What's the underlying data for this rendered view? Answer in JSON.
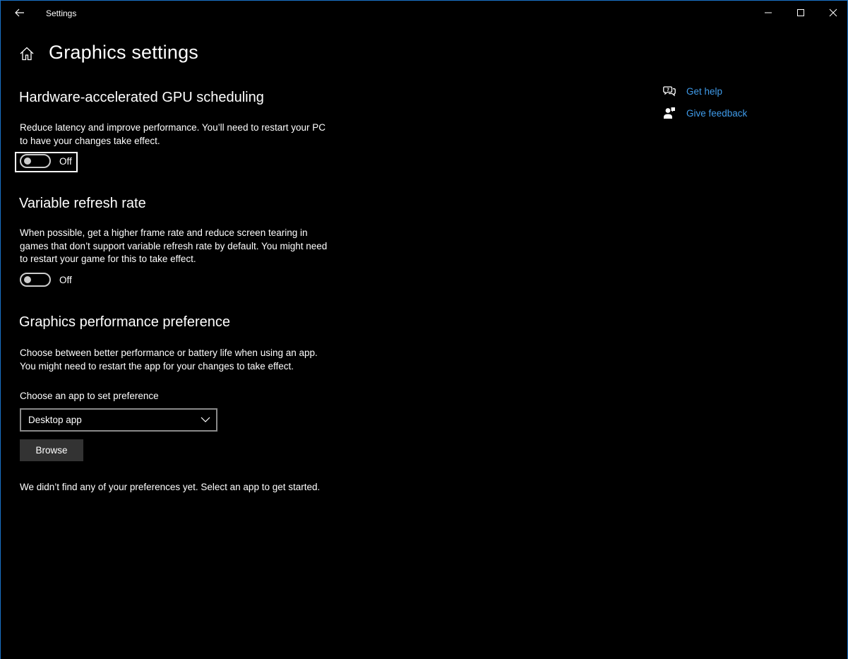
{
  "window": {
    "title": "Settings"
  },
  "header": {
    "title": "Graphics settings"
  },
  "gpu_scheduling": {
    "heading": "Hardware-accelerated GPU scheduling",
    "description": "Reduce latency and improve performance. You’ll need to restart your PC to have your changes take effect.",
    "toggle_state": "Off"
  },
  "variable_refresh": {
    "heading": "Variable refresh rate",
    "description": "When possible, get a higher frame rate and reduce screen tearing in games that don’t support variable refresh rate by default. You might need to restart your game for this to take effect.",
    "toggle_state": "Off"
  },
  "performance_pref": {
    "heading": "Graphics performance preference",
    "description": "Choose between better performance or battery life when using an app. You might need to restart the app for your changes to take effect.",
    "combo_label": "Choose an app to set preference",
    "combo_value": "Desktop app",
    "browse_label": "Browse",
    "empty_message": "We didn’t find any of your preferences yet. Select an app to get started."
  },
  "side_links": [
    {
      "label": "Get help",
      "icon": "get-help-icon"
    },
    {
      "label": "Give feedback",
      "icon": "feedback-icon"
    }
  ],
  "colors": {
    "background": "#000000",
    "accent_link": "#3f9bea",
    "window_border": "#1a73c8",
    "button_bg": "#333333"
  }
}
